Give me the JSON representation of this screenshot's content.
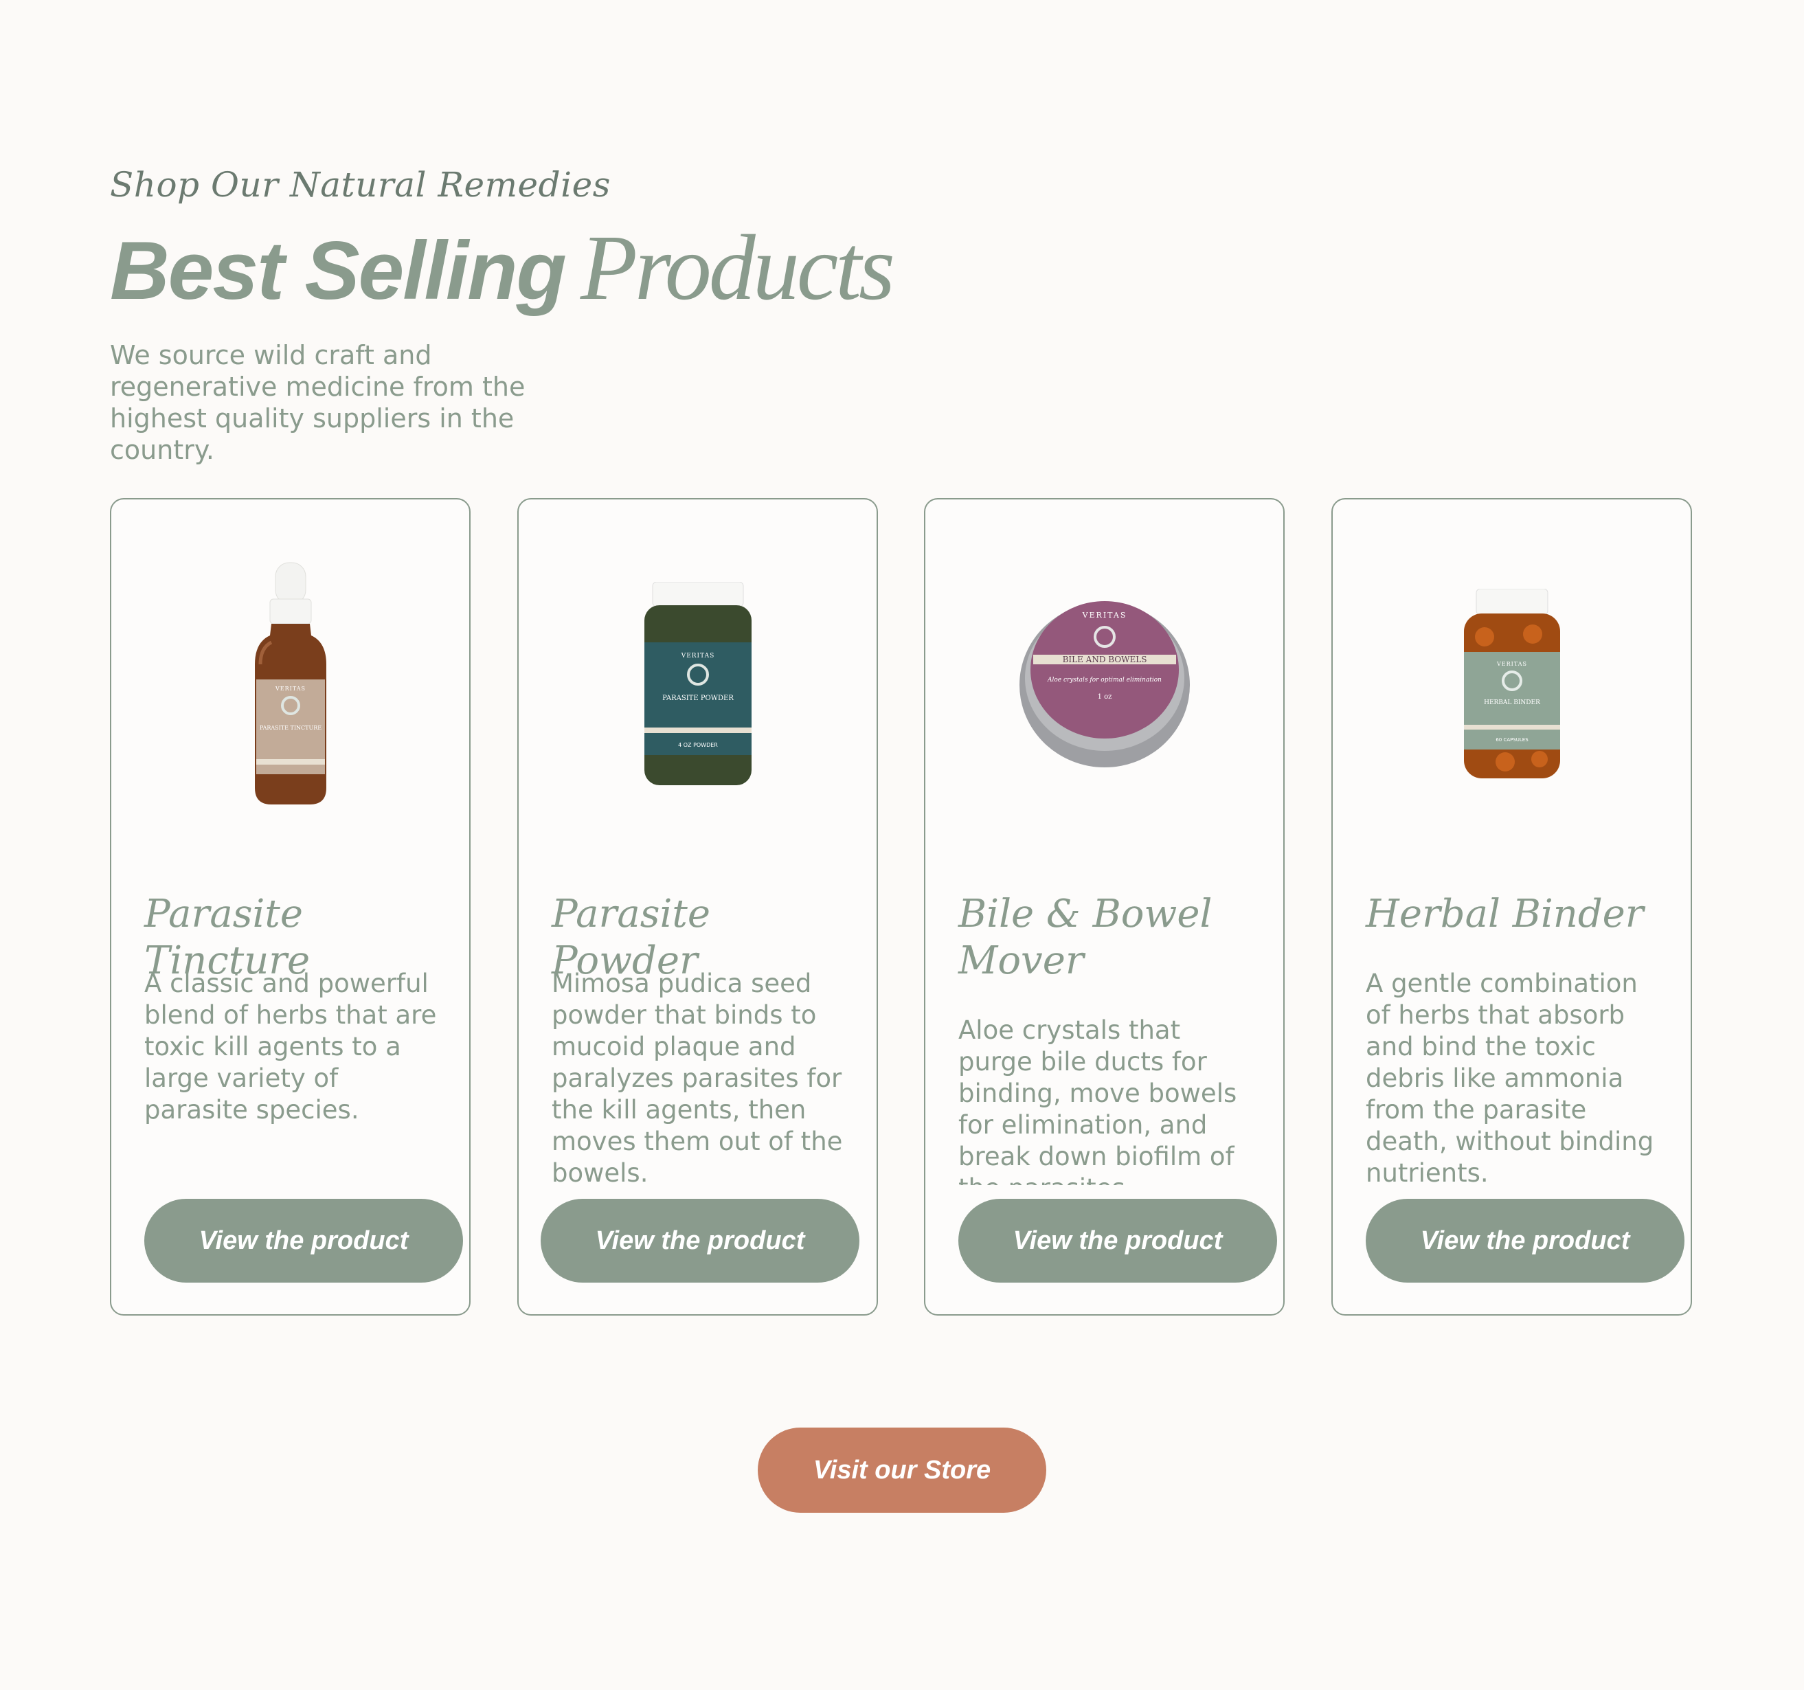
{
  "section": {
    "eyebrow": "Shop Our Natural Remedies",
    "title_bold": "Best Selling",
    "title_script": "Products",
    "description": "We source wild craft and regenerative medicine from the highest quality suppliers in the country."
  },
  "products": [
    {
      "name": "Parasite Tincture",
      "description": "A classic and powerful blend of herbs that are toxic kill agents to a large variety of parasite species.",
      "button_label": "View the product",
      "image": "amber-dropper-bottle",
      "label": {
        "brand": "VERITAS",
        "product": "PARASITE TINCTURE"
      }
    },
    {
      "name": "Parasite Powder",
      "description": "Mimosa pudica seed powder that binds to mucoid plaque and paralyzes parasites for the kill agents, then moves them out of the bowels.",
      "button_label": "View the product",
      "image": "powder-jar",
      "label": {
        "brand": "VERITAS",
        "product": "PARASITE POWDER",
        "size": "4 OZ POWDER"
      }
    },
    {
      "name": "Bile & Bowel Mover",
      "description": "Aloe crystals that purge bile ducts for binding, move bowels for elimination, and break down biofilm of the parasites.",
      "button_label": "View the product",
      "image": "tin-container",
      "label": {
        "brand": "VERITAS",
        "product": "BILE AND BOWELS",
        "tagline": "Aloe crystals for optimal elimination",
        "size": "1 oz"
      }
    },
    {
      "name": "Herbal Binder",
      "description": "A gentle combination of herbs that absorb and bind the toxic debris like ammonia from the parasite death, without binding nutrients.",
      "button_label": "View the product",
      "image": "capsule-bottle",
      "label": {
        "brand": "VERITAS",
        "product": "HERBAL BINDER",
        "size": "60 CAPSULES"
      }
    }
  ],
  "store_button": "Visit our Store",
  "colors": {
    "background": "#fcfaf8",
    "sage": "#8a9b8d",
    "terracotta": "#c77f63",
    "tincture_label": "#c2ab98",
    "powder_label": "#2f5c62",
    "tin_lid": "#94587b",
    "binder_label": "#8fa596"
  }
}
